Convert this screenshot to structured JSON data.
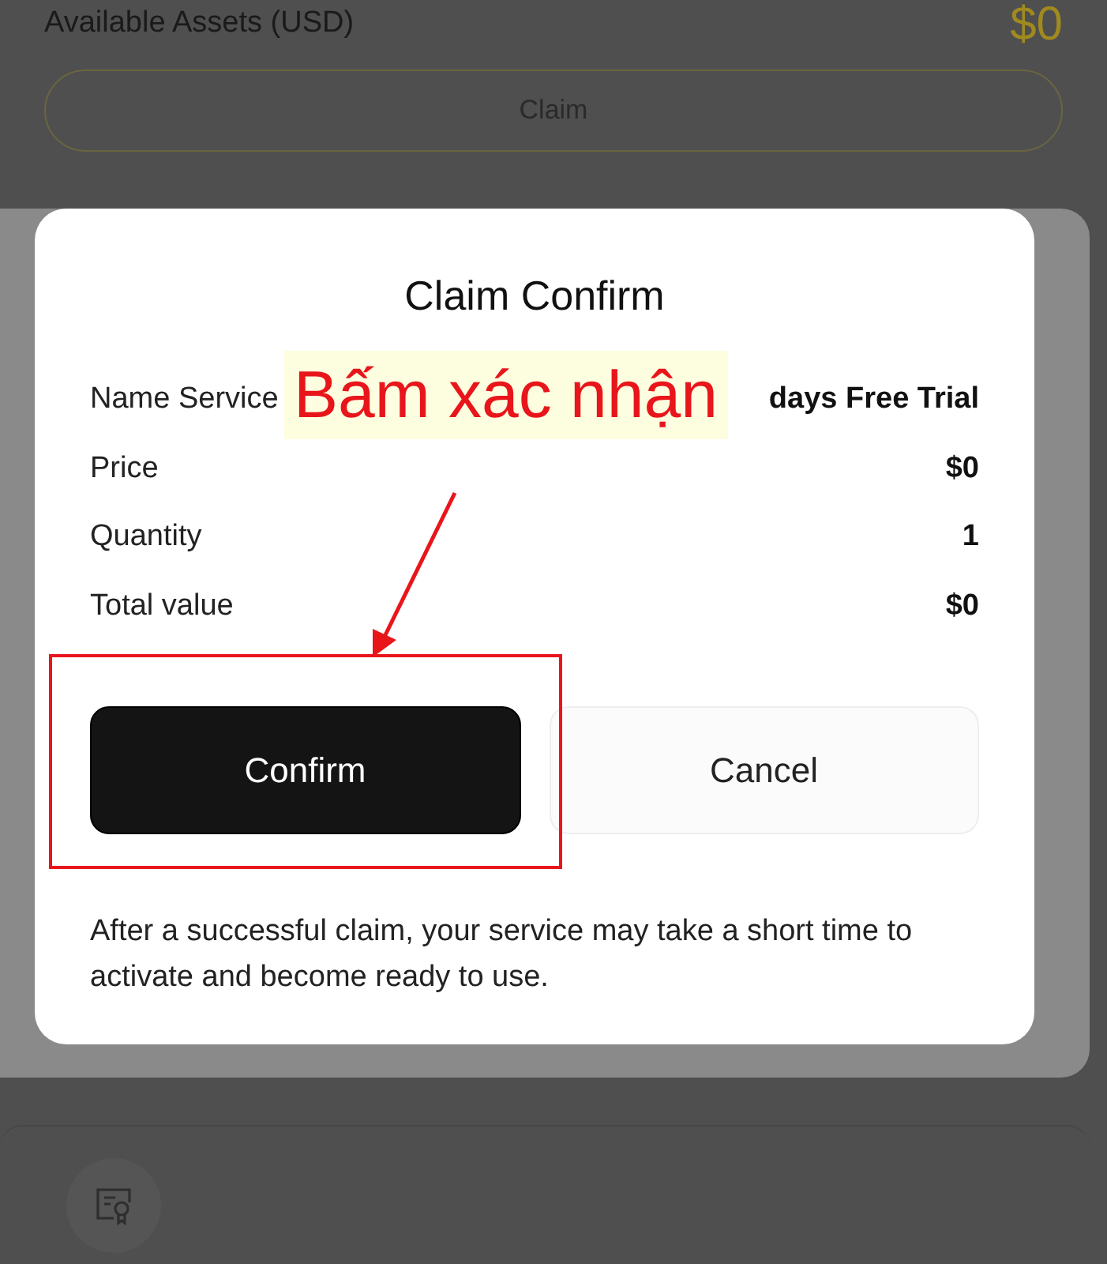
{
  "background": {
    "assets_label": "Available Assets (USD)",
    "assets_value": "$0",
    "claim_button": "Claim"
  },
  "dialog": {
    "title": "Claim Confirm",
    "rows": [
      {
        "label": "Name Service",
        "value": "days Free Trial"
      },
      {
        "label": "Price",
        "value": "$0"
      },
      {
        "label": "Quantity",
        "value": "1"
      },
      {
        "label": "Total value",
        "value": "$0"
      }
    ],
    "buttons": [
      {
        "label": "Confirm",
        "kind": "primary"
      },
      {
        "label": "Cancel",
        "kind": "secondary"
      }
    ],
    "note": "After a successful claim, your service may take a short time to activate and become ready to use."
  },
  "annotation": {
    "text": "Bấm xác nhận"
  }
}
